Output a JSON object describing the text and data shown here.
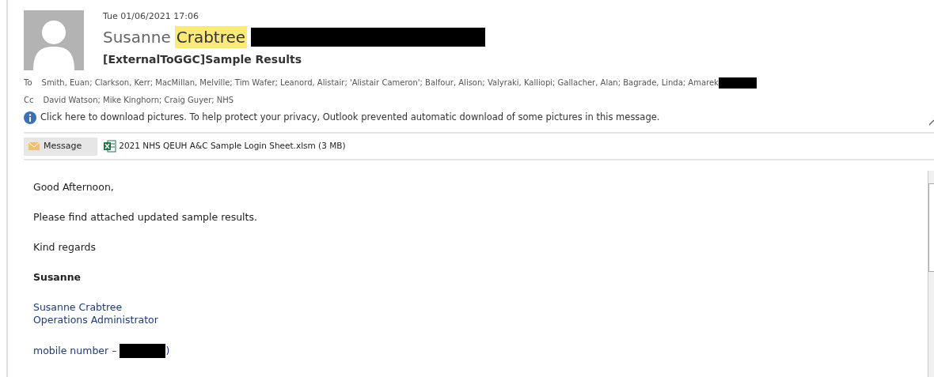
{
  "header": {
    "date": "Tue 01/06/2021 17:06",
    "sender_parts": [
      {
        "text": "Susanne",
        "highlighted": false
      },
      {
        "text": "Crabtree",
        "highlighted": true
      }
    ],
    "sender_redacted": true,
    "subject": "[ExternalToGGC]Sample Results",
    "to": {
      "label": "To",
      "value": "Smith, Euan; Clarkson, Kerr; MacMillan, Melville; Tim Wafer; Leanord, Alistair; 'Alistair Cameron'; Balfour, Alison; Valyraki, Kalliopi; Gallacher, Alan; Bagrade, Linda; Amarek",
      "redacted": true
    },
    "cc": {
      "label": "Cc",
      "value": "David Watson; Mike Kinghorn; Craig Guyer; NHS"
    },
    "info_bar": "Click here to download pictures. To help protect your privacy, Outlook prevented automatic download of some pictures in this message."
  },
  "attachments": [
    {
      "kind": "message",
      "label": "Message",
      "selected": true
    },
    {
      "kind": "excel",
      "label": "2021 NHS QEUH A&C Sample Login Sheet.xlsm (3 MB)",
      "selected": false
    }
  ],
  "body": [
    {
      "kind": "text",
      "text": "Good Afternoon,"
    },
    {
      "kind": "text",
      "text": "Please find attached updated sample results."
    },
    {
      "kind": "text",
      "text": "Kind regards"
    },
    {
      "kind": "bold",
      "text": "Susanne"
    },
    {
      "kind": "signature",
      "lines": [
        "Susanne Crabtree",
        "Operations Administrator"
      ]
    },
    {
      "kind": "phone",
      "text": "mobile number –",
      "after": ")"
    }
  ]
}
